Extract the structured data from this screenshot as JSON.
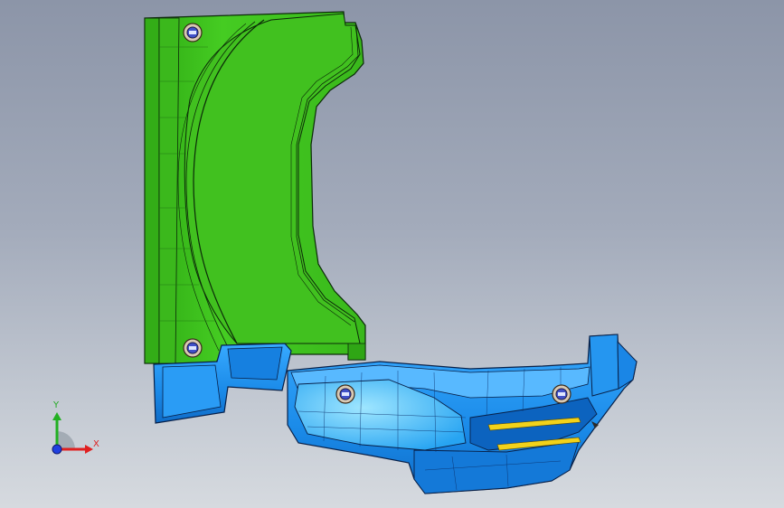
{
  "viewport": {
    "background_top": "#8c95a8",
    "background_bottom": "#d6dadf"
  },
  "model": {
    "part_green_color": "#3ec41c",
    "part_blue_color": "#1f93f0",
    "edge_color": "#0a2a0a"
  },
  "triad": {
    "x_label": "X",
    "y_label": "Y",
    "x_color": "#e02020",
    "y_color": "#22b022",
    "z_color": "#2040e0"
  }
}
